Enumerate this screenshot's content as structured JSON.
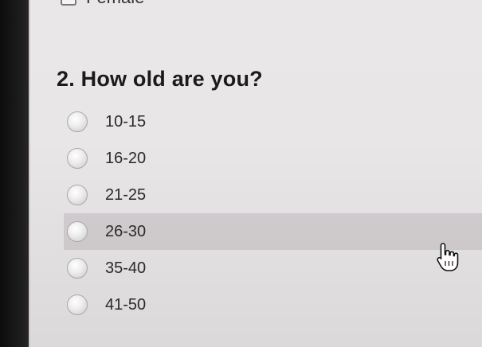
{
  "previous_question": {
    "option_label": "Female"
  },
  "question": {
    "text": "2. How old are you?",
    "options": [
      {
        "label": "10-15",
        "selected": false
      },
      {
        "label": "16-20",
        "selected": false
      },
      {
        "label": "21-25",
        "selected": false
      },
      {
        "label": "26-30",
        "selected": false
      },
      {
        "label": "35-40",
        "selected": false
      },
      {
        "label": "41-50",
        "selected": false
      }
    ],
    "hovered_option": "26-30"
  },
  "cursor": {
    "icon": "hand-pointer-icon"
  }
}
